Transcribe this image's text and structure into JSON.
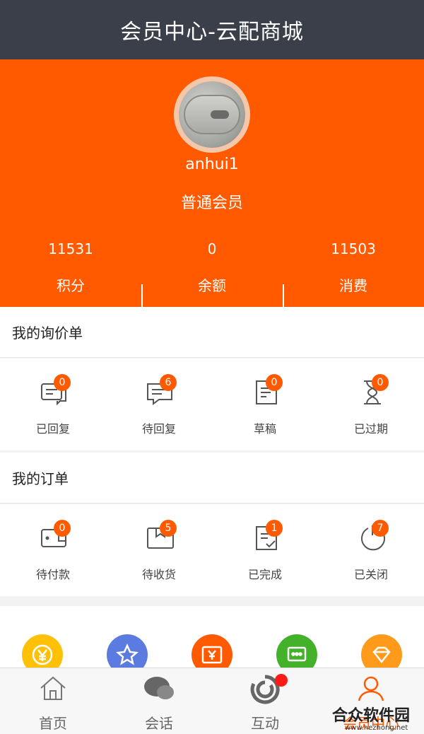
{
  "header": {
    "title": "会员中心-云配商城"
  },
  "profile": {
    "username": "anhui1",
    "level": "普通会员",
    "stats": [
      {
        "value": "11531",
        "label": "积分"
      },
      {
        "value": "0",
        "label": "余额"
      },
      {
        "value": "11503",
        "label": "消费"
      }
    ]
  },
  "inquiry": {
    "title": "我的询价单",
    "items": [
      {
        "label": "已回复",
        "count": "0",
        "icon": "reply-icon"
      },
      {
        "label": "待回复",
        "count": "6",
        "icon": "chat-pending-icon"
      },
      {
        "label": "草稿",
        "count": "0",
        "icon": "draft-icon"
      },
      {
        "label": "已过期",
        "count": "0",
        "icon": "hourglass-icon"
      }
    ]
  },
  "orders": {
    "title": "我的订单",
    "items": [
      {
        "label": "待付款",
        "count": "0",
        "icon": "wallet-icon"
      },
      {
        "label": "待收货",
        "count": "5",
        "icon": "package-icon"
      },
      {
        "label": "已完成",
        "count": "1",
        "icon": "completed-doc-icon"
      },
      {
        "label": "已关闭",
        "count": "7",
        "icon": "closed-icon"
      }
    ]
  },
  "quick_icons": [
    {
      "icon": "yen-coin-icon",
      "color": "#ffc107"
    },
    {
      "icon": "star-icon",
      "color": "#5b7be0"
    },
    {
      "icon": "coupon-icon",
      "color": "#ff5a00"
    },
    {
      "icon": "message-icon",
      "color": "#44b12a"
    },
    {
      "icon": "diamond-icon",
      "color": "#ff9a1a"
    }
  ],
  "tabs": [
    {
      "label": "首页",
      "icon": "home-icon"
    },
    {
      "label": "会话",
      "icon": "chat-icon"
    },
    {
      "label": "互动",
      "icon": "interact-icon"
    },
    {
      "label": "会员中心",
      "icon": "user-icon"
    }
  ],
  "watermark": {
    "line1": "合众软件园",
    "line2": "www.hezhong.net"
  },
  "colors": {
    "accent": "#ff5a00",
    "header": "#3a3f4a"
  }
}
